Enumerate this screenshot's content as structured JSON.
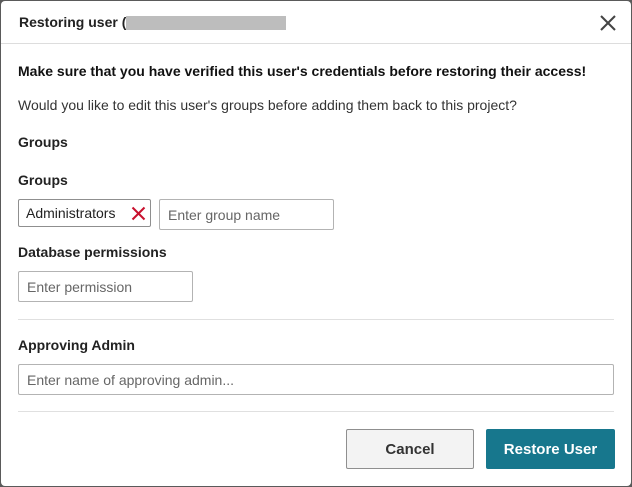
{
  "dialog": {
    "title": "Restoring user (",
    "warning": "Make sure that you have verified this user's credentials before restoring their access!",
    "question": "Would you like to edit this user's groups before adding them back to this project?",
    "section_groups_heading": "Groups",
    "groups_label": "Groups",
    "selected_groups": [
      "Administrators"
    ],
    "group_input": {
      "value": "",
      "placeholder": "Enter group name"
    },
    "db_permissions_label": "Database permissions",
    "permission_input": {
      "value": "",
      "placeholder": "Enter permission"
    },
    "approving_admin_label": "Approving Admin",
    "admin_input": {
      "value": "",
      "placeholder": "Enter name of approving admin..."
    },
    "cancel_label": "Cancel",
    "restore_label": "Restore User"
  },
  "icons": {
    "close": "close-icon",
    "remove_tag": "remove-tag-icon"
  },
  "colors": {
    "primary": "#17778d",
    "remove": "#c8102e",
    "redaction": "#bdbdbd"
  }
}
